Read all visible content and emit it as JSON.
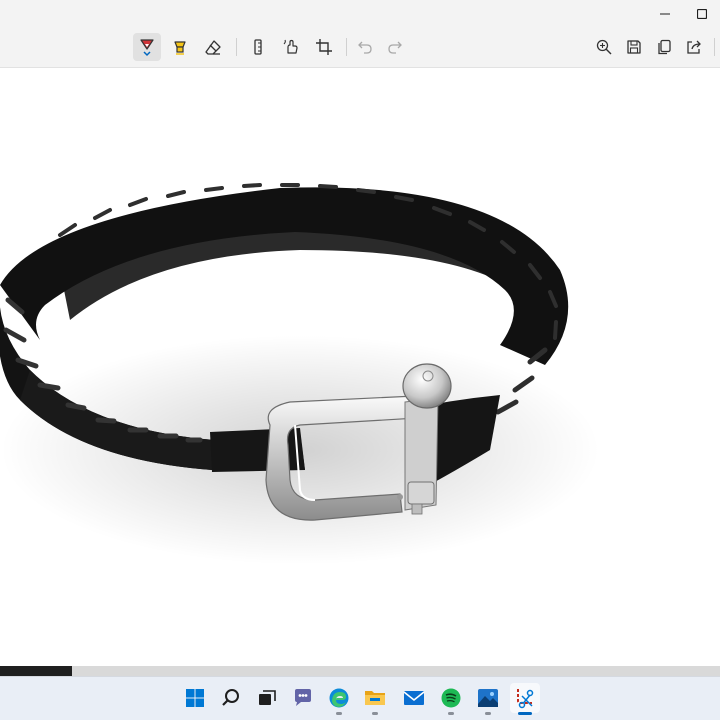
{
  "window": {
    "minimize_icon": "minimize-icon",
    "maximize_icon": "maximize-icon"
  },
  "toolbar": {
    "tools": [
      {
        "name": "ballpoint-pen",
        "icon": "pen-icon",
        "color": "#d13438",
        "active": true
      },
      {
        "name": "highlighter",
        "icon": "highlighter-icon",
        "color": "#f5c518"
      },
      {
        "name": "eraser",
        "icon": "eraser-icon"
      },
      {
        "name": "ruler",
        "icon": "ruler-icon"
      },
      {
        "name": "touch-writing",
        "icon": "touch-writing-icon"
      },
      {
        "name": "crop",
        "icon": "crop-icon"
      },
      {
        "name": "undo",
        "icon": "undo-icon",
        "disabled": true
      },
      {
        "name": "redo",
        "icon": "redo-icon",
        "disabled": true
      }
    ],
    "actions": [
      {
        "name": "zoom",
        "icon": "zoom-in-icon"
      },
      {
        "name": "save",
        "icon": "save-icon"
      },
      {
        "name": "copy",
        "icon": "copy-icon"
      },
      {
        "name": "share",
        "icon": "share-icon"
      }
    ]
  },
  "canvas": {
    "image": "leather-bracelet-with-silver-shackle-clasp",
    "background": "#ffffff",
    "scroll_position": 0.0
  },
  "taskbar": {
    "icons": [
      {
        "name": "start",
        "icon": "windows-start-icon"
      },
      {
        "name": "search",
        "icon": "search-icon"
      },
      {
        "name": "task-view",
        "icon": "task-view-icon"
      },
      {
        "name": "chat",
        "icon": "teams-chat-icon"
      },
      {
        "name": "edge",
        "icon": "edge-browser-icon",
        "running": true
      },
      {
        "name": "file-explorer",
        "icon": "folder-icon",
        "running": true
      },
      {
        "name": "mail",
        "icon": "mail-icon"
      },
      {
        "name": "spotify",
        "icon": "spotify-icon",
        "running": true
      },
      {
        "name": "photos",
        "icon": "photos-icon",
        "running": true
      },
      {
        "name": "snipping-tool",
        "icon": "snipping-tool-icon",
        "running": true,
        "active": true
      }
    ],
    "accent": "#0067c0"
  }
}
